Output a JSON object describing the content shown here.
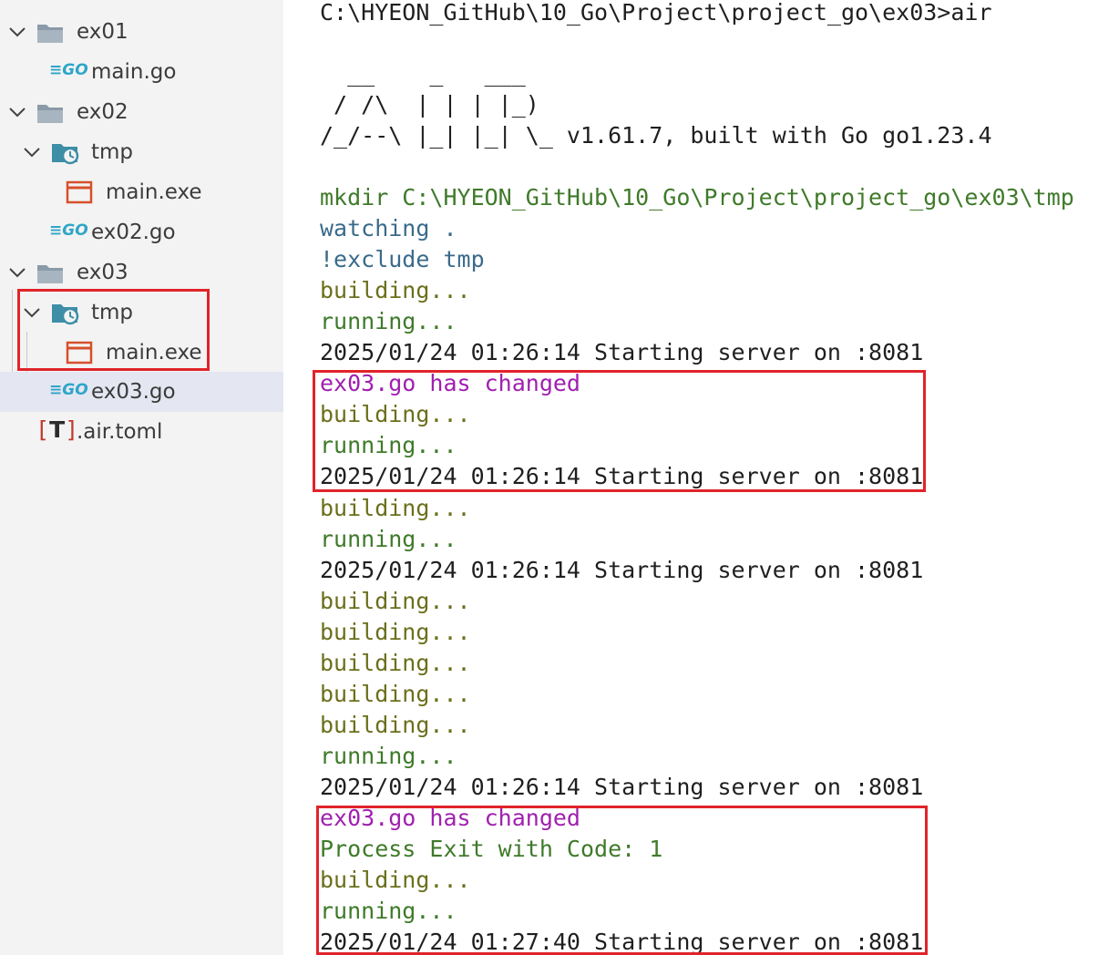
{
  "explorer": {
    "top_fragment": "",
    "items": [
      {
        "label": "ex01",
        "type": "folder",
        "expanded": true
      },
      {
        "label": "main.go",
        "type": "go"
      },
      {
        "label": "ex02",
        "type": "folder",
        "expanded": true
      },
      {
        "label": "tmp",
        "type": "special-folder",
        "expanded": true
      },
      {
        "label": "main.exe",
        "type": "exe"
      },
      {
        "label": "ex02.go",
        "type": "go"
      },
      {
        "label": "ex03",
        "type": "folder",
        "expanded": true
      },
      {
        "label": "tmp",
        "type": "special-folder",
        "expanded": true
      },
      {
        "label": "main.exe",
        "type": "exe"
      },
      {
        "label": "ex03.go",
        "type": "go",
        "selected": true
      },
      {
        "label": ".air.toml",
        "type": "toml"
      }
    ],
    "go_badge": "GO",
    "toml_badge": "T"
  },
  "terminal": {
    "lines": [
      {
        "text": "C:\\HYEON_GitHub\\10_Go\\Project\\project_go\\ex03>air",
        "color": "default"
      },
      {
        "text": "",
        "color": "default"
      },
      {
        "text": "  __    _   ___",
        "color": "default"
      },
      {
        "text": " / /\\  | | | |_)",
        "color": "default"
      },
      {
        "text": "/_/--\\ |_| |_| \\_ v1.61.7, built with Go go1.23.4",
        "color": "default"
      },
      {
        "text": "",
        "color": "default"
      },
      {
        "text": "mkdir C:\\HYEON_GitHub\\10_Go\\Project\\project_go\\ex03\\tmp",
        "color": "green"
      },
      {
        "text": "watching .",
        "color": "blue"
      },
      {
        "text": "!exclude tmp",
        "color": "blue"
      },
      {
        "text": "building...",
        "color": "olive"
      },
      {
        "text": "running...",
        "color": "green"
      },
      {
        "text": "2025/01/24 01:26:14 Starting server on :8081",
        "color": "default"
      },
      {
        "text": "ex03.go has changed",
        "color": "magenta"
      },
      {
        "text": "building...",
        "color": "olive"
      },
      {
        "text": "running...",
        "color": "green"
      },
      {
        "text": "2025/01/24 01:26:14 Starting server on :8081",
        "color": "default"
      },
      {
        "text": "building...",
        "color": "olive"
      },
      {
        "text": "running...",
        "color": "green"
      },
      {
        "text": "2025/01/24 01:26:14 Starting server on :8081",
        "color": "default"
      },
      {
        "text": "building...",
        "color": "olive"
      },
      {
        "text": "building...",
        "color": "olive"
      },
      {
        "text": "building...",
        "color": "olive"
      },
      {
        "text": "building...",
        "color": "olive"
      },
      {
        "text": "building...",
        "color": "olive"
      },
      {
        "text": "running...",
        "color": "green"
      },
      {
        "text": "2025/01/24 01:26:14 Starting server on :8081",
        "color": "default"
      },
      {
        "text": "ex03.go has changed",
        "color": "magenta"
      },
      {
        "text": "Process Exit with Code: 1",
        "color": "green"
      },
      {
        "text": "building...",
        "color": "olive"
      },
      {
        "text": "running...",
        "color": "green"
      },
      {
        "text": "2025/01/24 01:27:40 Starting server on :8081",
        "color": "default"
      }
    ]
  },
  "colors": {
    "highlight": "#e0242a",
    "selection": "#e4e6f1",
    "folder": "#8a9aa8",
    "special_folder": "#3d8ea6",
    "go": "#2fa5c8",
    "exe": "#d5502c",
    "toml": "#c0392b"
  }
}
